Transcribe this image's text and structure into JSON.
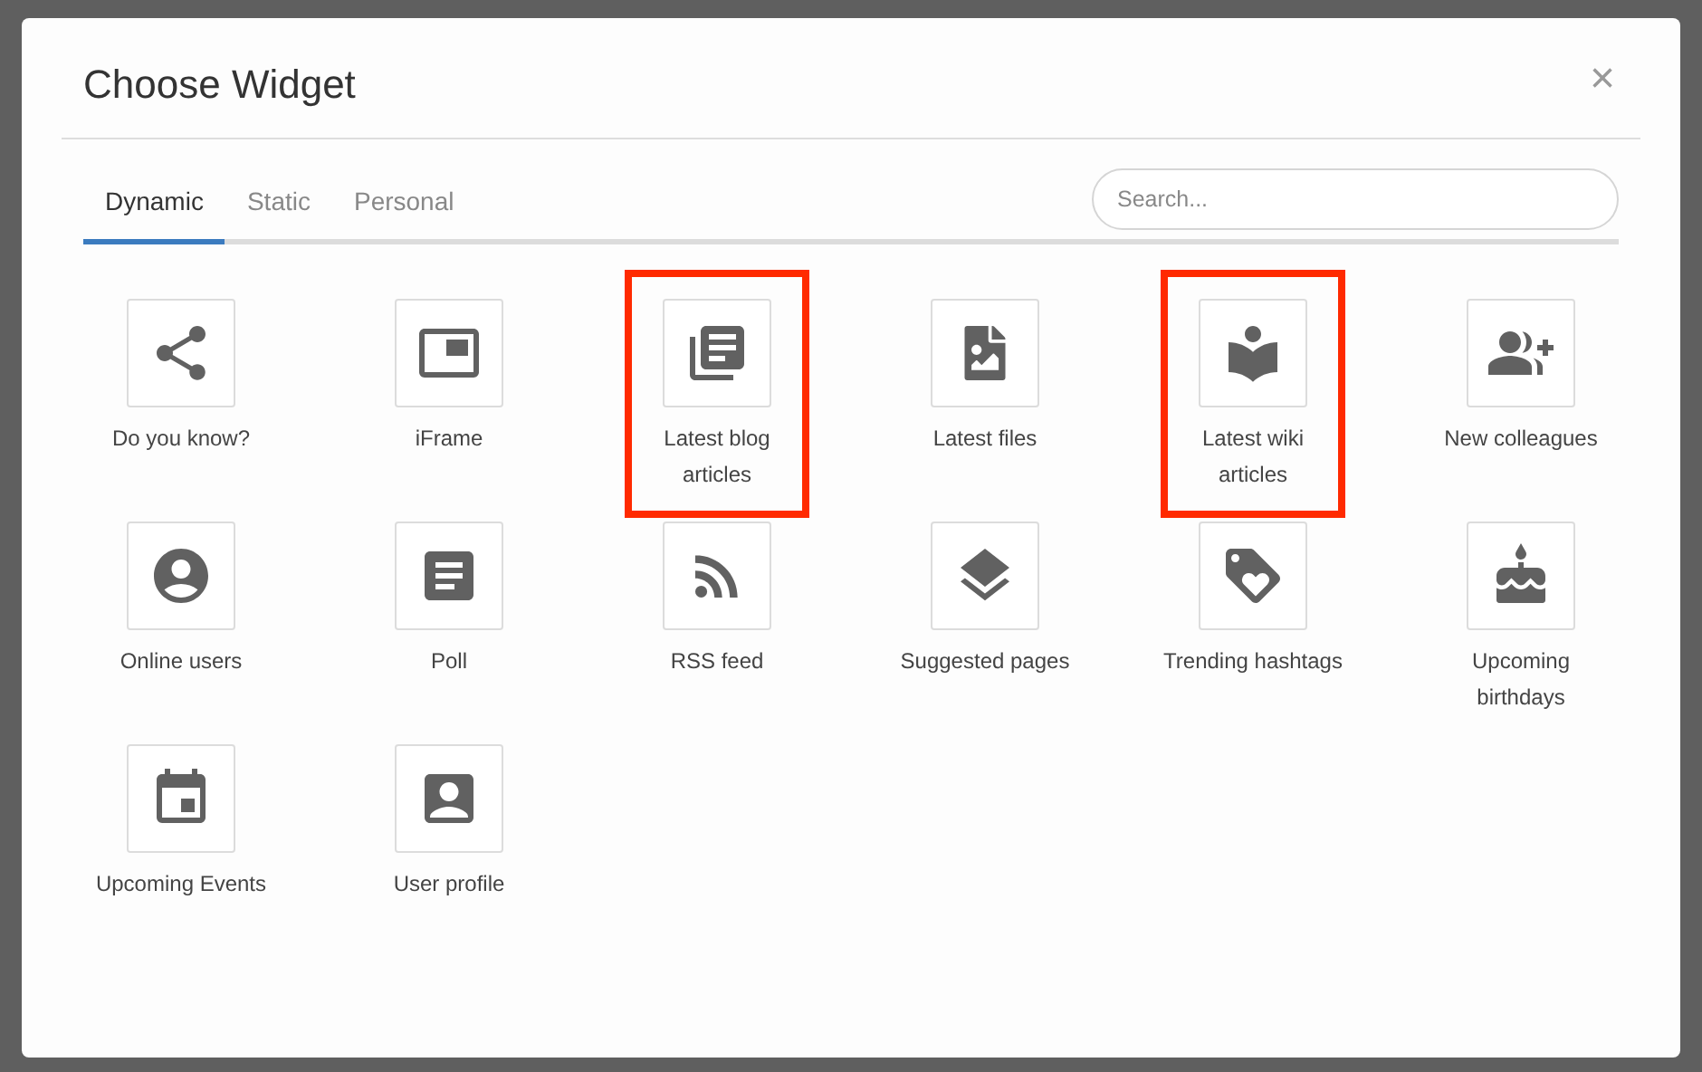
{
  "dialog": {
    "title": "Choose Widget",
    "close": "×"
  },
  "tabs": [
    {
      "label": "Dynamic",
      "selected": true
    },
    {
      "label": "Static",
      "selected": false
    },
    {
      "label": "Personal",
      "selected": false
    }
  ],
  "search": {
    "placeholder": "Search..."
  },
  "widgets": [
    {
      "label": "Do you know?",
      "highlighted": false
    },
    {
      "label": "iFrame",
      "highlighted": false
    },
    {
      "label": "Latest blog articles",
      "highlighted": true
    },
    {
      "label": "Latest files",
      "highlighted": false
    },
    {
      "label": "Latest wiki articles",
      "highlighted": true
    },
    {
      "label": "New colleagues",
      "highlighted": false
    },
    {
      "label": "Online users",
      "highlighted": false
    },
    {
      "label": "Poll",
      "highlighted": false
    },
    {
      "label": "RSS feed",
      "highlighted": false
    },
    {
      "label": "Suggested pages",
      "highlighted": false
    },
    {
      "label": "Trending hashtags",
      "highlighted": false
    },
    {
      "label": "Upcoming birthdays",
      "highlighted": false
    },
    {
      "label": "Upcoming Events",
      "highlighted": false
    },
    {
      "label": "User profile",
      "highlighted": false
    }
  ]
}
